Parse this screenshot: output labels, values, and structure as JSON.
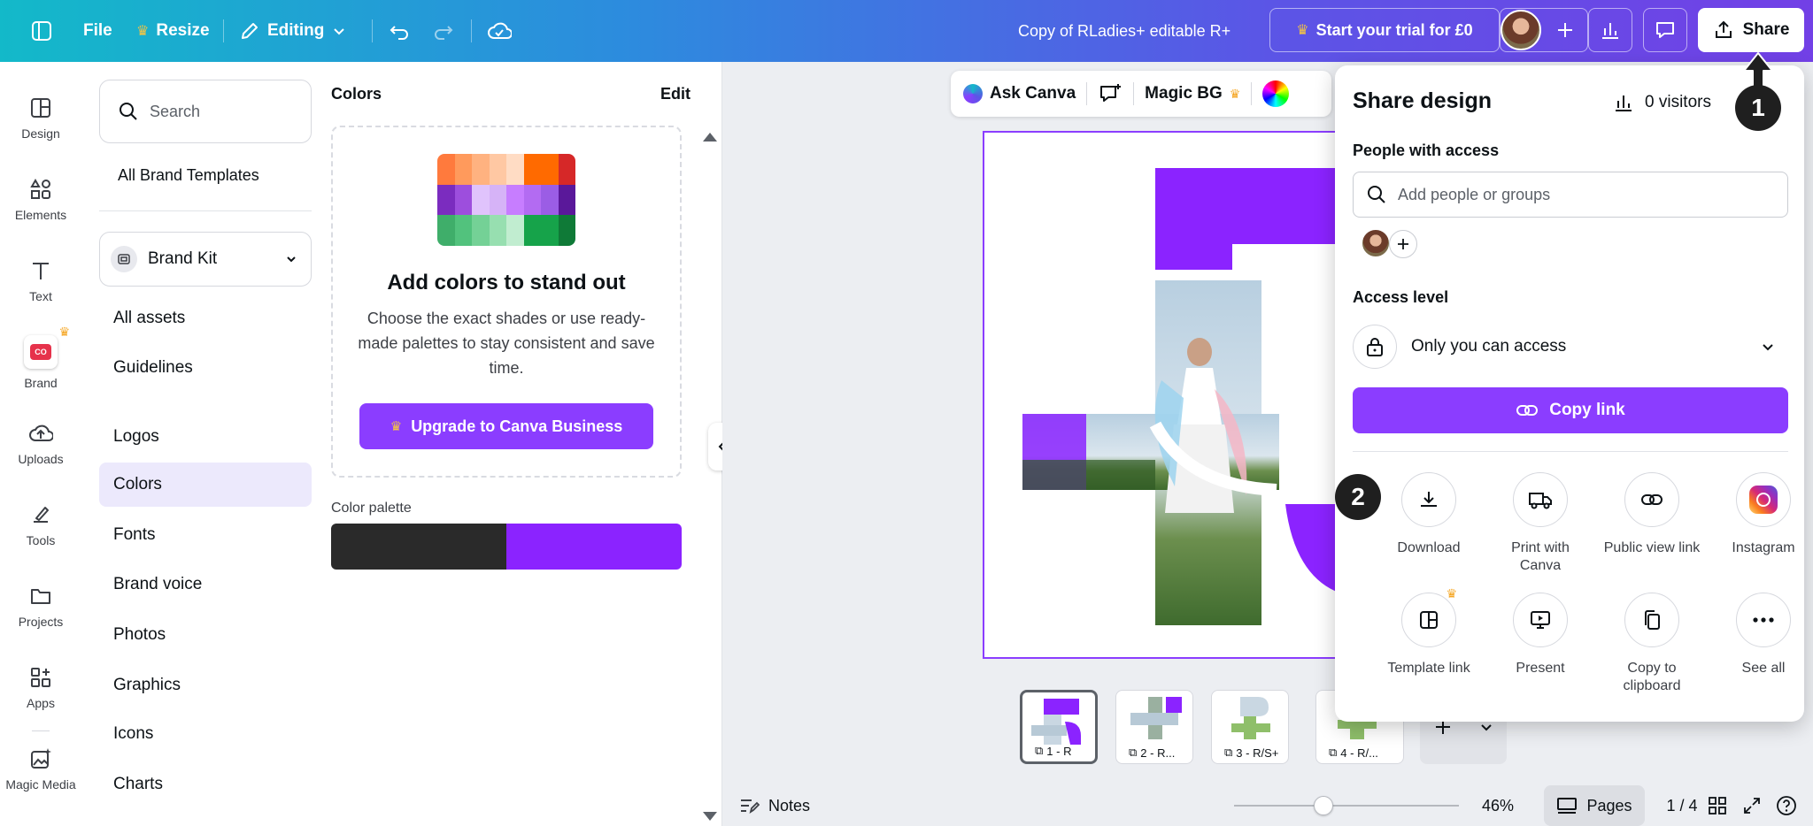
{
  "topbar": {
    "file": "File",
    "resize": "Resize",
    "editing": "Editing",
    "doc_title": "Copy of RLadies+ editable R+",
    "trial": "Start your trial for £0",
    "share": "Share"
  },
  "rail": {
    "items": [
      {
        "label": "Design",
        "icon": "design-icon"
      },
      {
        "label": "Elements",
        "icon": "elements-icon"
      },
      {
        "label": "Text",
        "icon": "text-icon"
      },
      {
        "label": "Brand",
        "icon": "brand-icon"
      },
      {
        "label": "Uploads",
        "icon": "uploads-icon"
      },
      {
        "label": "Tools",
        "icon": "tools-icon"
      },
      {
        "label": "Projects",
        "icon": "projects-icon"
      },
      {
        "label": "Apps",
        "icon": "apps-icon"
      },
      {
        "label": "Magic Media",
        "icon": "magic-media-icon"
      }
    ]
  },
  "panel": {
    "search_placeholder": "Search",
    "all_brand_templates": "All Brand Templates",
    "brand_kit": "Brand Kit",
    "nav": [
      "All assets",
      "Guidelines",
      "Logos",
      "Colors",
      "Fonts",
      "Brand voice",
      "Photos",
      "Graphics",
      "Icons",
      "Charts"
    ],
    "active_nav": "Colors",
    "colors_heading": "Colors",
    "edit": "Edit",
    "promo_title": "Add colors to stand out",
    "promo_text": "Choose the exact shades or use ready-made palettes to stay consistent and save time.",
    "upgrade": "Upgrade to Canva Business",
    "color_palette_label": "Color palette",
    "palette_colors": [
      "#2a2a2a",
      "#8b23ff"
    ]
  },
  "canvas": {
    "ask_canva": "Ask Canva",
    "magic_bg": "Magic BG",
    "thumbs": [
      "1 - R",
      "2 - R...",
      "3 - R/S+",
      "4 - R/..."
    ],
    "notes": "Notes",
    "zoom": "46%",
    "pages": "Pages",
    "page_count": "1 / 4"
  },
  "share_dialog": {
    "title": "Share design",
    "visitors": "0 visitors",
    "people_heading": "People with access",
    "add_placeholder": "Add people or groups",
    "access_heading": "Access level",
    "access_value": "Only you can access",
    "copy_link": "Copy link",
    "options": [
      {
        "label": "Download",
        "icon": "download-icon"
      },
      {
        "label": "Print with Canva",
        "icon": "truck-icon"
      },
      {
        "label": "Public view link",
        "icon": "link-icon"
      },
      {
        "label": "Instagram",
        "icon": "instagram-icon"
      },
      {
        "label": "Template link",
        "icon": "template-icon"
      },
      {
        "label": "Present",
        "icon": "present-icon"
      },
      {
        "label": "Copy to clipboard",
        "icon": "clipboard-icon"
      },
      {
        "label": "See all",
        "icon": "more-icon"
      }
    ]
  },
  "annotations": {
    "step1": "1",
    "step2": "2"
  },
  "colors": {
    "brand_purple": "#8b3dff",
    "crown": "#f5a623"
  }
}
